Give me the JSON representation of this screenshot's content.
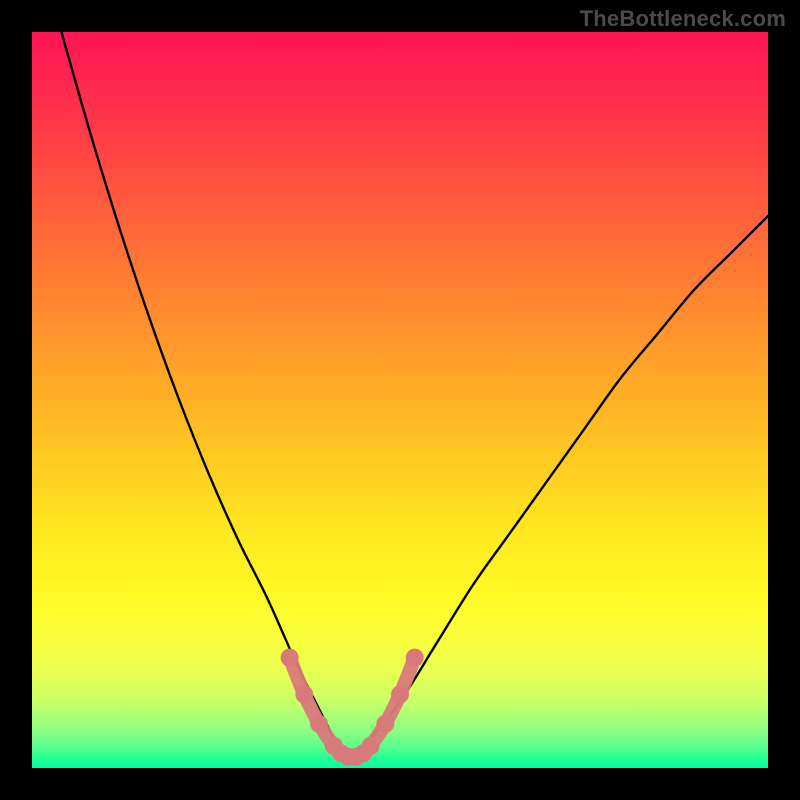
{
  "watermark": "TheBottleneck.com",
  "chart_data": {
    "type": "line",
    "title": "",
    "xlabel": "",
    "ylabel": "",
    "xlim": [
      0,
      100
    ],
    "ylim": [
      0,
      100
    ],
    "grid": false,
    "legend": false,
    "series": [
      {
        "name": "curve",
        "color": "#000000",
        "x": [
          4,
          8,
          12,
          16,
          20,
          24,
          28,
          32,
          36,
          38,
          40,
          41,
          42,
          43,
          44,
          45,
          46,
          50,
          55,
          60,
          65,
          70,
          75,
          80,
          85,
          90,
          95,
          100
        ],
        "values": [
          100,
          86,
          73,
          61,
          50,
          40,
          31,
          23,
          14,
          10,
          6,
          4,
          2,
          1,
          1,
          2,
          4,
          9,
          17,
          25,
          32,
          39,
          46,
          53,
          59,
          65,
          70,
          75
        ]
      }
    ],
    "markers": {
      "name": "bottom-dots",
      "color": "#d97a7a",
      "points": [
        {
          "x": 35,
          "y": 15
        },
        {
          "x": 37,
          "y": 10
        },
        {
          "x": 39,
          "y": 6
        },
        {
          "x": 41,
          "y": 3
        },
        {
          "x": 42,
          "y": 2
        },
        {
          "x": 43,
          "y": 1.5
        },
        {
          "x": 44,
          "y": 1.5
        },
        {
          "x": 45,
          "y": 2
        },
        {
          "x": 46,
          "y": 3
        },
        {
          "x": 48,
          "y": 6
        },
        {
          "x": 50,
          "y": 10
        },
        {
          "x": 52,
          "y": 15
        }
      ]
    }
  }
}
